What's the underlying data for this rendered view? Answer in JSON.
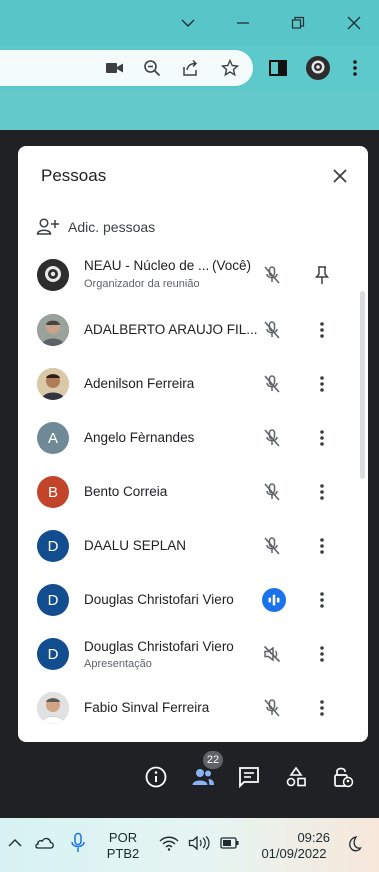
{
  "panel": {
    "title": "Pessoas",
    "add_label": "Adic. pessoas"
  },
  "participants": [
    {
      "name": "NEAU - Núcleo de ...",
      "suffix": "(Você)",
      "subtitle": "Organizador da reunião",
      "avatar": "logo",
      "action": "pin"
    },
    {
      "name": "ADALBERTO ARAUJO FIL...",
      "avatar": "photo",
      "action": "more"
    },
    {
      "name": "Adenilson Ferreira",
      "avatar": "photo",
      "action": "more"
    },
    {
      "name": "Angelo Fèrnandes",
      "initial": "A",
      "avatar_color": "#6f8a96",
      "action": "more"
    },
    {
      "name": "Bento Correia",
      "initial": "B",
      "avatar_color": "#c1442b",
      "action": "more"
    },
    {
      "name": "DAALU SEPLAN",
      "initial": "D",
      "avatar_color": "#114d8f",
      "action": "more"
    },
    {
      "name": "Douglas Christofari Viero",
      "initial": "D",
      "avatar_color": "#114d8f",
      "speaking": true,
      "action": "more"
    },
    {
      "name": "Douglas Christofari Viero",
      "subtitle": "Apresentação",
      "initial": "D",
      "avatar_color": "#114d8f",
      "presentation": true,
      "action": "more"
    },
    {
      "name": "Fabio Sinval Ferreira",
      "avatar": "photo",
      "action": "more"
    }
  ],
  "bottom_bar": {
    "people_count": "22"
  },
  "taskbar": {
    "lang_line1": "POR",
    "lang_line2": "PTB2",
    "time": "09:26",
    "date": "01/09/2022"
  },
  "colors": {
    "titlebar": "#58c6c8",
    "accent_blue": "#1a73e8",
    "speaking_blue": "#1a73e8"
  }
}
